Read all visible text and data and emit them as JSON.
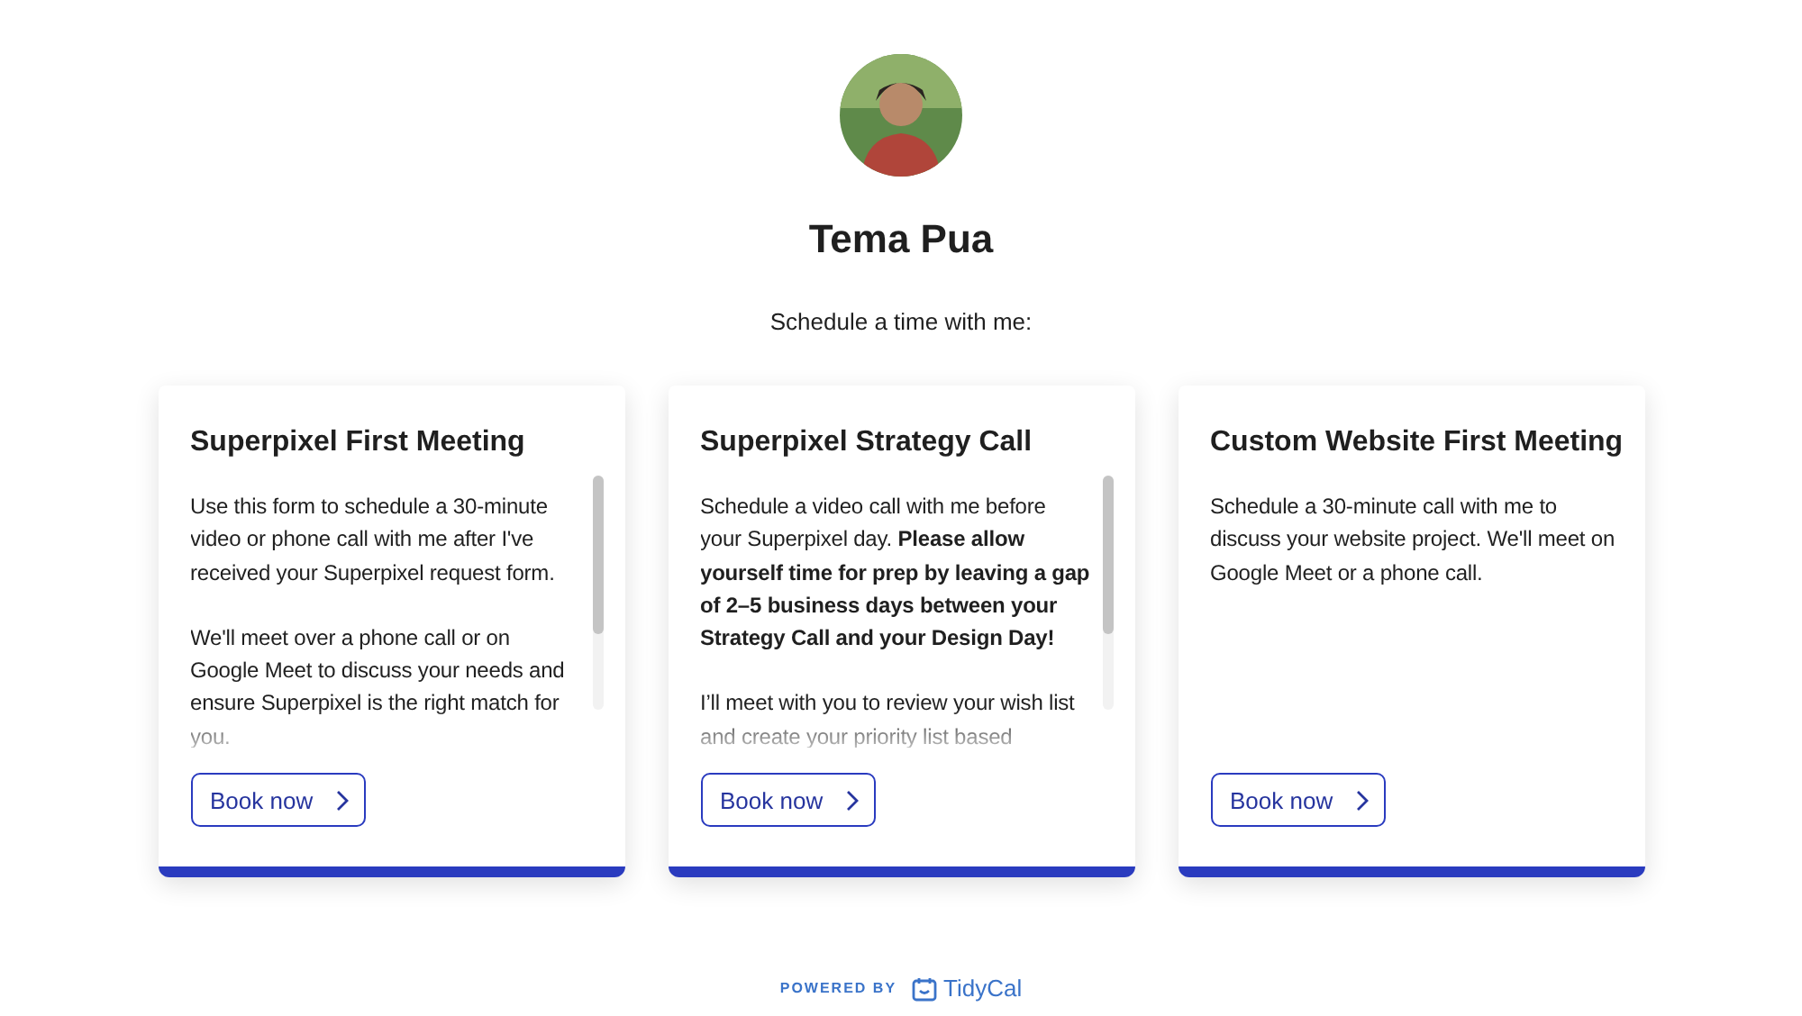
{
  "profile": {
    "name": "Tema Pua",
    "subtitle": "Schedule a time with me:"
  },
  "cards": [
    {
      "title": "Superpixel First Meeting",
      "has_scrollbar": true,
      "paragraphs": [
        "Use this form to schedule a 30-minute video or phone call with me after I've received your Superpixel request form.",
        "We'll meet over a phone call or on Google Meet to discuss your needs and ensure Superpixel is the right match for you."
      ],
      "button": "Book now"
    },
    {
      "title": "Superpixel Strategy Call",
      "has_scrollbar": true,
      "paragraphs": [
        "Schedule a video call with me before your Superpixel day. **Please allow yourself time for prep by leaving a gap of 2–5 business days between your Strategy Call and your Design Day!**",
        "I’ll meet with you to review your wish list and create your priority list based"
      ],
      "button": "Book now"
    },
    {
      "title": "Custom Website First Meeting",
      "has_scrollbar": false,
      "paragraphs": [
        "Schedule a 30-minute call with me to discuss your website project. We'll meet on Google Meet or a phone call."
      ],
      "button": "Book now"
    }
  ],
  "footer": {
    "powered_by": "POWERED BY",
    "brand": "TidyCal"
  }
}
